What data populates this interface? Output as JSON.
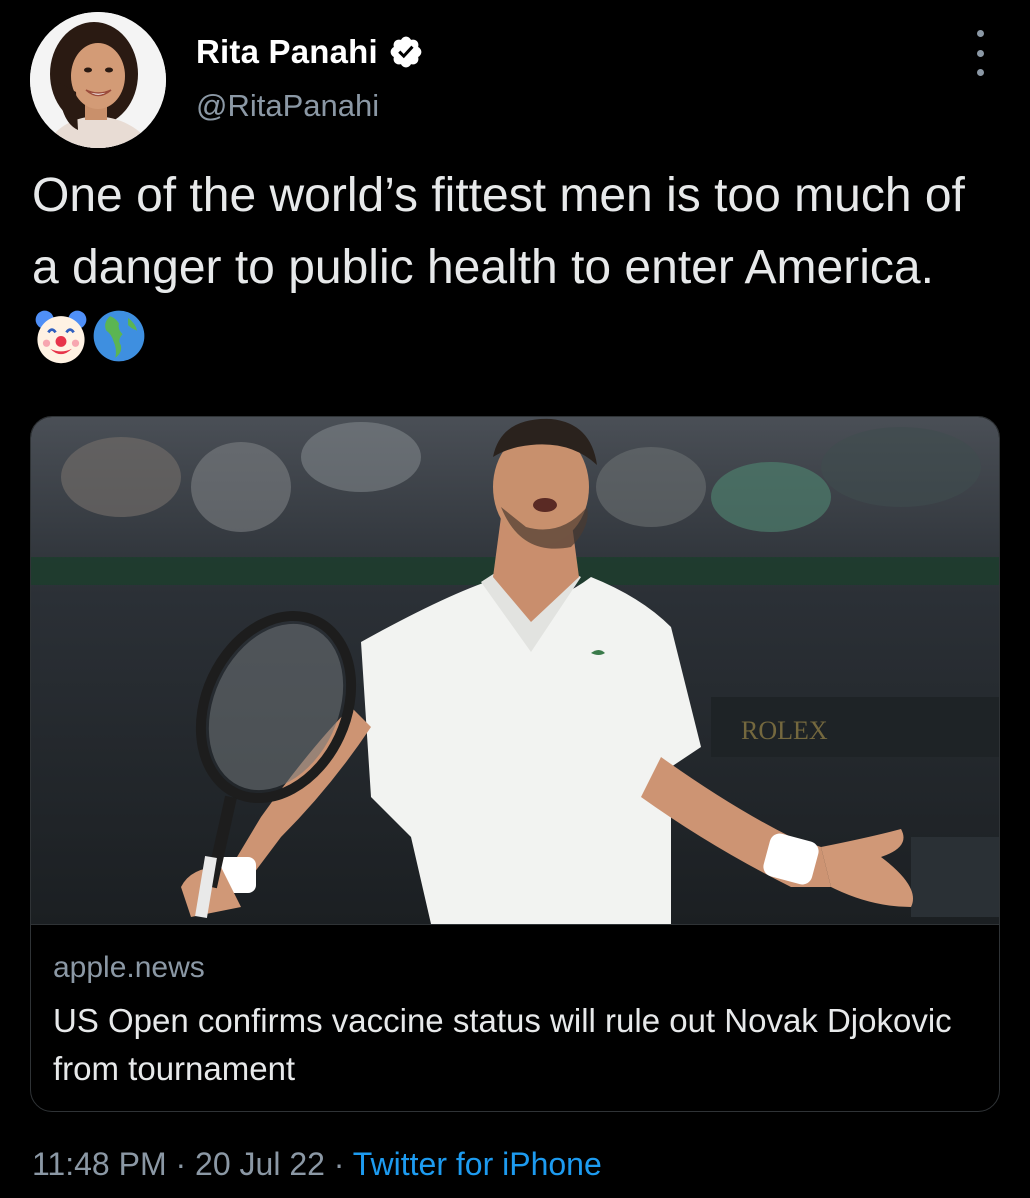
{
  "tweet": {
    "author": {
      "display_name": "Rita Panahi",
      "handle": "@RitaPanahi",
      "verified": true,
      "avatar_icon": "profile-photo"
    },
    "text": "One of the world’s fittest men is too much of a danger to public health to enter America.",
    "emojis": [
      "clown-face",
      "globe-showing-americas"
    ],
    "link_card": {
      "domain": "apple.news",
      "title": "US Open confirms vaccine status will rule out Novak Djokovic from tournament",
      "image": "tennis-player-photo"
    },
    "meta": {
      "time": "11:48 PM",
      "separator": "·",
      "date": "20 Jul 22",
      "source": "Twitter for iPhone"
    }
  },
  "colors": {
    "background": "#000000",
    "text_primary": "#e7e9ea",
    "text_secondary": "#8b98a5",
    "link": "#1d9bf0",
    "verified_badge": "#ffffff",
    "border": "#2f3336"
  }
}
